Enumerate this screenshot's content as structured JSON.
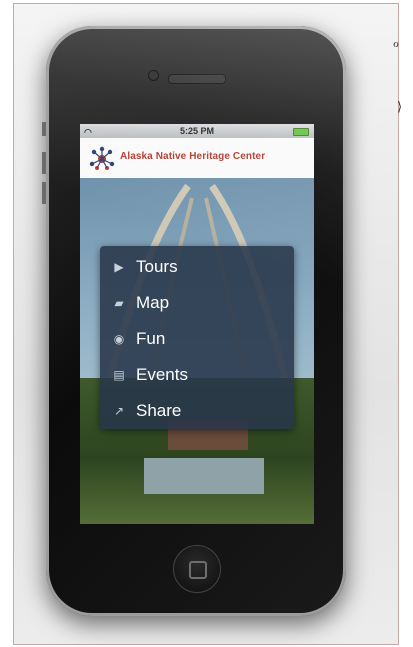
{
  "status_bar": {
    "time": "5:25 PM"
  },
  "app": {
    "title": "Alaska Native Heritage Center",
    "logo_icon": "heritage-logo-icon",
    "brand_color": "#b03a2e"
  },
  "menu": {
    "items": [
      {
        "label": "Tours",
        "icon": "play-icon"
      },
      {
        "label": "Map",
        "icon": "map-icon"
      },
      {
        "label": "Fun",
        "icon": "fun-icon"
      },
      {
        "label": "Events",
        "icon": "calendar-icon"
      },
      {
        "label": "Share",
        "icon": "share-icon"
      }
    ]
  },
  "margin_marks": [
    "ℴ",
    "⟩"
  ]
}
